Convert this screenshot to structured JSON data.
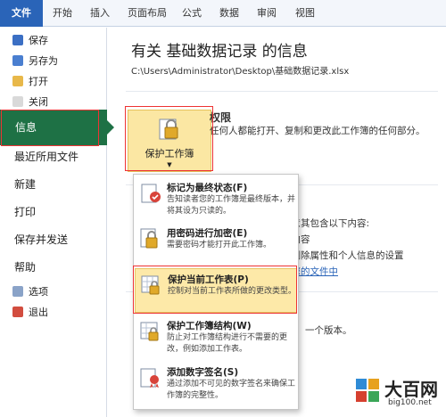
{
  "ribbon": {
    "tabs": [
      "文件",
      "开始",
      "插入",
      "页面布局",
      "公式",
      "数据",
      "审阅",
      "视图"
    ]
  },
  "sidebar": {
    "small_items": [
      "保存",
      "另存为",
      "打开",
      "关闭"
    ],
    "info": "信息",
    "items": [
      "最近所用文件",
      "新建",
      "打印",
      "保存并发送",
      "帮助"
    ],
    "small_items2": [
      "选项",
      "退出"
    ]
  },
  "main": {
    "title": "有关 基础数据记录 的信息",
    "path": "C:\\Users\\Administrator\\Desktop\\基础数据记录.xlsx",
    "protect_button": "保护工作簿",
    "permissions_title": "权限",
    "permissions_desc": "任何人都能打开、复制和更改此工作簿的任何部分。",
    "partial": {
      "line1": "注意其包含以下内容:",
      "line2": "的内容",
      "line3": "动删除属性和个人信息的设置",
      "line4": "在您的文件中",
      "line5": "一个版本。"
    }
  },
  "menu": {
    "items": [
      {
        "title": "标记为最终状态(F)",
        "desc": "告知读者您的工作簿是最终版本，并将其设为只读的。"
      },
      {
        "title": "用密码进行加密(E)",
        "desc": "需要密码才能打开此工作簿。"
      },
      {
        "title": "保护当前工作表(P)",
        "desc": "控制对当前工作表所做的更改类型。"
      },
      {
        "title": "保护工作簿结构(W)",
        "desc": "防止对工作簿结构进行不需要的更改，例如添加工作表。"
      },
      {
        "title": "添加数字签名(S)",
        "desc": "通过添加不可见的数字签名来确保工作簿的完整性。"
      }
    ]
  },
  "watermark": {
    "text": "大百网",
    "url": "big100.net"
  },
  "colors": {
    "file_tab": "#2a64b8",
    "info_selected": "#1e7145",
    "highlight": "#fde9a8",
    "red_box": "#e33"
  }
}
